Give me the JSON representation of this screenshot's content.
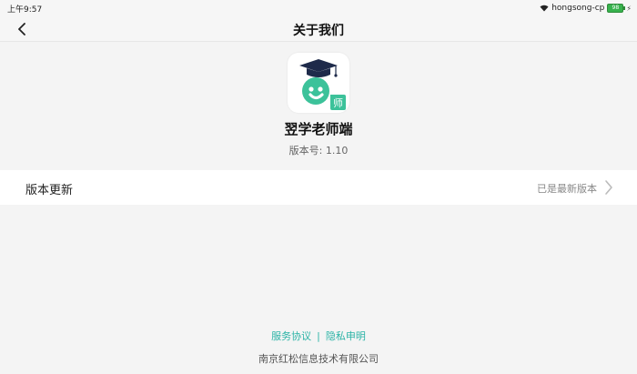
{
  "status_bar": {
    "time": "上午9:57",
    "network_name": "hongsong-cp",
    "battery_level": "98",
    "icons": [
      "wifi-icon",
      "battery-icon",
      "charging-bolt-icon"
    ]
  },
  "nav": {
    "back_icon": "chevron-left-icon",
    "title": "关于我们"
  },
  "app": {
    "name": "翌学老师端",
    "version": "版本号: 1.10",
    "logo_badge": "师",
    "colors": {
      "brand_green": "#3cc29a",
      "cap_navy": "#1e2a4a"
    }
  },
  "update": {
    "label": "版本更新",
    "status": "已是最新版本",
    "icon": "chevron-right-icon"
  },
  "footer": {
    "service_agreement": "服务协议",
    "divider": "|",
    "privacy_statement": "隐私申明",
    "company": "南京红松信息技术有限公司",
    "link_color": "#2bb3a6"
  }
}
